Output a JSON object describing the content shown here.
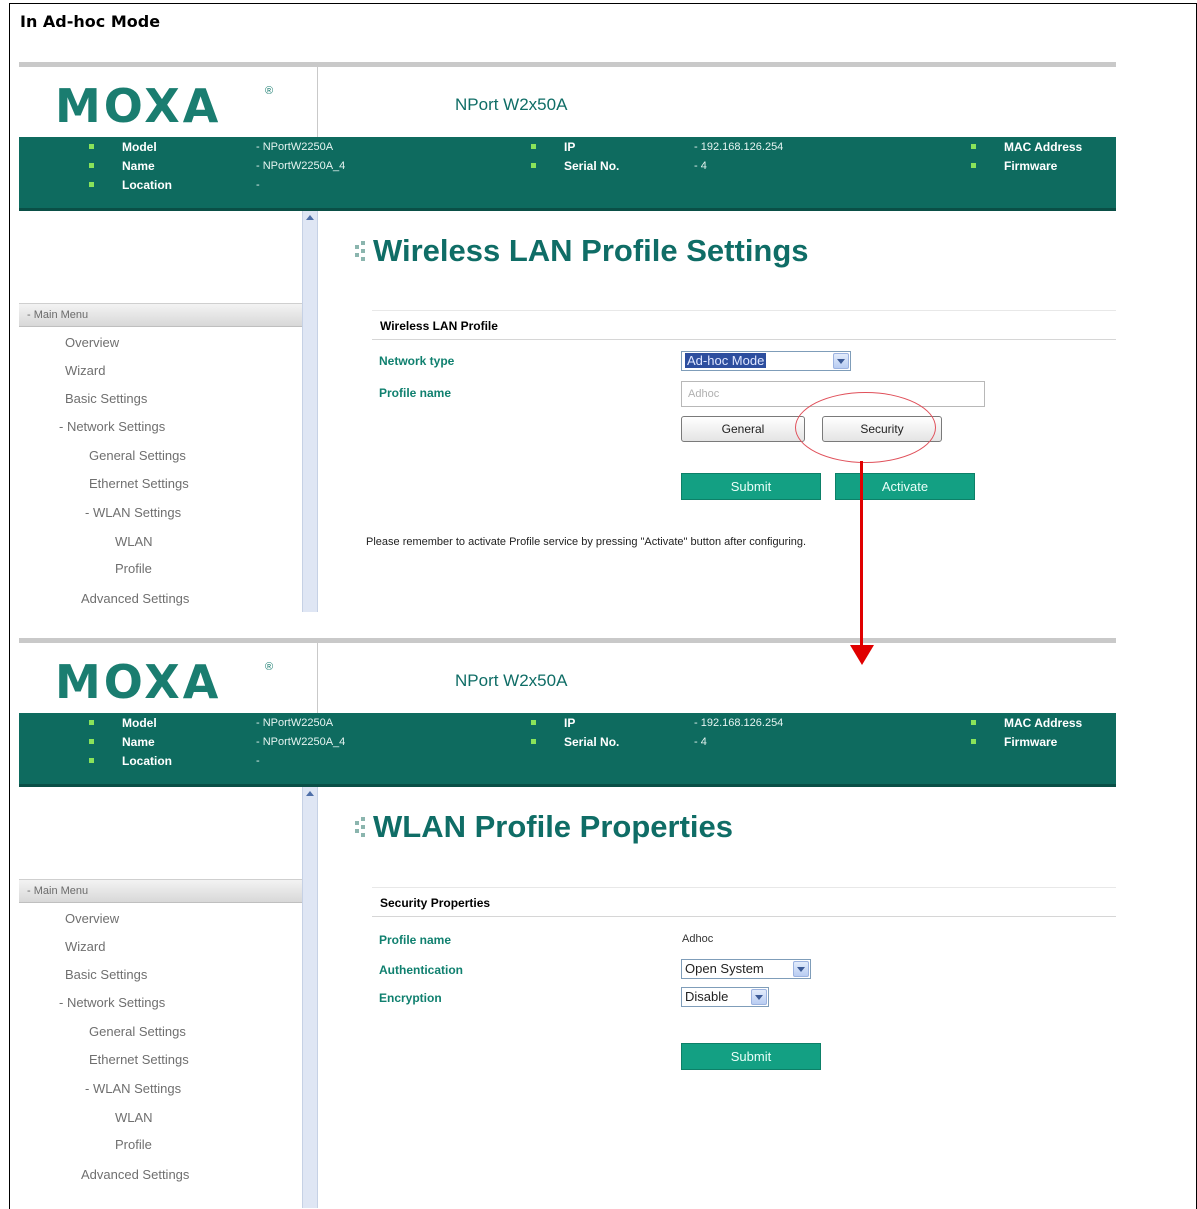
{
  "frame_title": "In Ad-hoc Mode",
  "logo": {
    "text": "MOXA",
    "reg": "®"
  },
  "product": "NPort W2x50A",
  "info": {
    "model_label": "Model",
    "name_label": "Name",
    "location_label": "Location",
    "model_value": "- NPortW2250A",
    "name_value": "- NPortW2250A_4",
    "location_value": "-",
    "ip_label": "IP",
    "serial_label": "Serial No.",
    "ip_value": "- 192.168.126.254",
    "serial_value": "- 4",
    "mac_label": "MAC Address",
    "firmware_label": "Firmware"
  },
  "menu": {
    "head": "- Main Menu",
    "items": [
      "Overview",
      "Wizard",
      "Basic Settings",
      "- Network Settings",
      "General Settings",
      "Ethernet Settings",
      "- WLAN Settings",
      "WLAN",
      "Profile",
      "Advanced Settings"
    ]
  },
  "screen1": {
    "title": "Wireless LAN Profile Settings",
    "section": "Wireless LAN Profile",
    "network_type_label": "Network type",
    "network_type_value": "Ad-hoc Mode",
    "profile_name_label": "Profile name",
    "profile_name_value": "Adhoc",
    "general_button": "General",
    "security_button": "Security",
    "submit_button": "Submit",
    "activate_button": "Activate",
    "note": "Please remember to activate Profile service by pressing \"Activate\" button after configuring."
  },
  "screen2": {
    "title": "WLAN Profile Properties",
    "section": "Security Properties",
    "profile_name_label": "Profile name",
    "profile_name_value": "Adhoc",
    "authentication_label": "Authentication",
    "authentication_value": "Open System",
    "encryption_label": "Encryption",
    "encryption_value": "Disable",
    "submit_button": "Submit"
  },
  "colors": {
    "brand": "#0e6b5f",
    "accent": "#13a083",
    "callout": "#e00000"
  }
}
